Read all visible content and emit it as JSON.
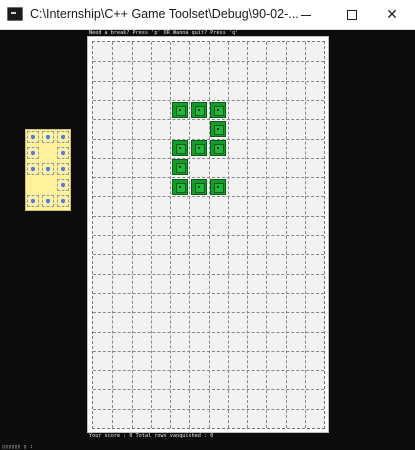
{
  "window": {
    "title": "C:\\Internship\\C++ Game Toolset\\Debug\\90-02-...",
    "minimize_icon": "minimize-icon",
    "maximize_icon": "maximize-icon",
    "close_icon": "close-icon",
    "close_glyph": "✕"
  },
  "console": {
    "top_hint": "Need a break? Press 'p' OR Wanna quit? Press 'q'",
    "score_line": "Your score : 0 Total rows vanquished : 0",
    "prompt_line": "\u001b[?25l\u001b[33m ···"
  },
  "board": {
    "columns": 12,
    "rows": 20,
    "filled_cells": [
      {
        "col": 4,
        "row": 3
      },
      {
        "col": 5,
        "row": 3
      },
      {
        "col": 6,
        "row": 3
      },
      {
        "col": 6,
        "row": 4
      },
      {
        "col": 4,
        "row": 5
      },
      {
        "col": 5,
        "row": 5
      },
      {
        "col": 6,
        "row": 5
      },
      {
        "col": 4,
        "row": 6
      },
      {
        "col": 4,
        "row": 7
      },
      {
        "col": 5,
        "row": 7
      },
      {
        "col": 6,
        "row": 7
      }
    ],
    "block_color": "#159a2b",
    "background_color": "#f2f2f2"
  },
  "preview": {
    "background_color": "#fef29c",
    "dot_color": "#5b7fd6"
  }
}
